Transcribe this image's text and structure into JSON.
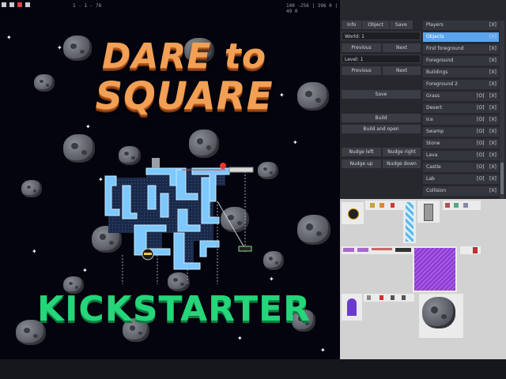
{
  "topbar": {
    "level_readout": "1 - 1 - 78",
    "coords_readout": "140 -256 | 396 0 | 49 0"
  },
  "game": {
    "title_line1": "DARE to",
    "title_line2": "SQUARE",
    "kickstarter_text": "KICKSTARTER",
    "title_color": "#f2a055",
    "kickstarter_color": "#25d57a"
  },
  "tabs": [
    {
      "label": "Info"
    },
    {
      "label": "Object"
    },
    {
      "label": "Save"
    }
  ],
  "form": {
    "world_label": "World: 1",
    "level_label": "Level: 1",
    "previous": "Previous",
    "next": "Next",
    "save": "Save",
    "build": "Build",
    "build_and_open": "Build and open",
    "nudge_left": "Nudge left",
    "nudge_right": "Nudge right",
    "nudge_up": "Nudge up",
    "nudge_down": "Nudge down"
  },
  "layers": [
    {
      "name": "Players",
      "tag1": "",
      "tag2": "[X]"
    },
    {
      "name": "Objects",
      "tag1": "",
      "tag2": "[X]",
      "selected": true
    },
    {
      "name": "First foreground",
      "tag1": "",
      "tag2": "[X]"
    },
    {
      "name": "Foreground",
      "tag1": "",
      "tag2": "[X]"
    },
    {
      "name": "Buildings",
      "tag1": "",
      "tag2": "[X]"
    },
    {
      "name": "Foreground 2",
      "tag1": "",
      "tag2": "[X]"
    },
    {
      "name": "Grass",
      "tag1": "[O]",
      "tag2": "[X]"
    },
    {
      "name": "Desert",
      "tag1": "[O]",
      "tag2": "[X]"
    },
    {
      "name": "Ice",
      "tag1": "[O]",
      "tag2": "[X]"
    },
    {
      "name": "Swamp",
      "tag1": "[O]",
      "tag2": "[X]"
    },
    {
      "name": "Stone",
      "tag1": "[O]",
      "tag2": "[X]"
    },
    {
      "name": "Lava",
      "tag1": "[O]",
      "tag2": "[X]"
    },
    {
      "name": "Castle",
      "tag1": "[O]",
      "tag2": "[X]"
    },
    {
      "name": "Lab",
      "tag1": "[O]",
      "tag2": "[X]"
    },
    {
      "name": "Collision",
      "tag1": "",
      "tag2": "[X]"
    }
  ]
}
